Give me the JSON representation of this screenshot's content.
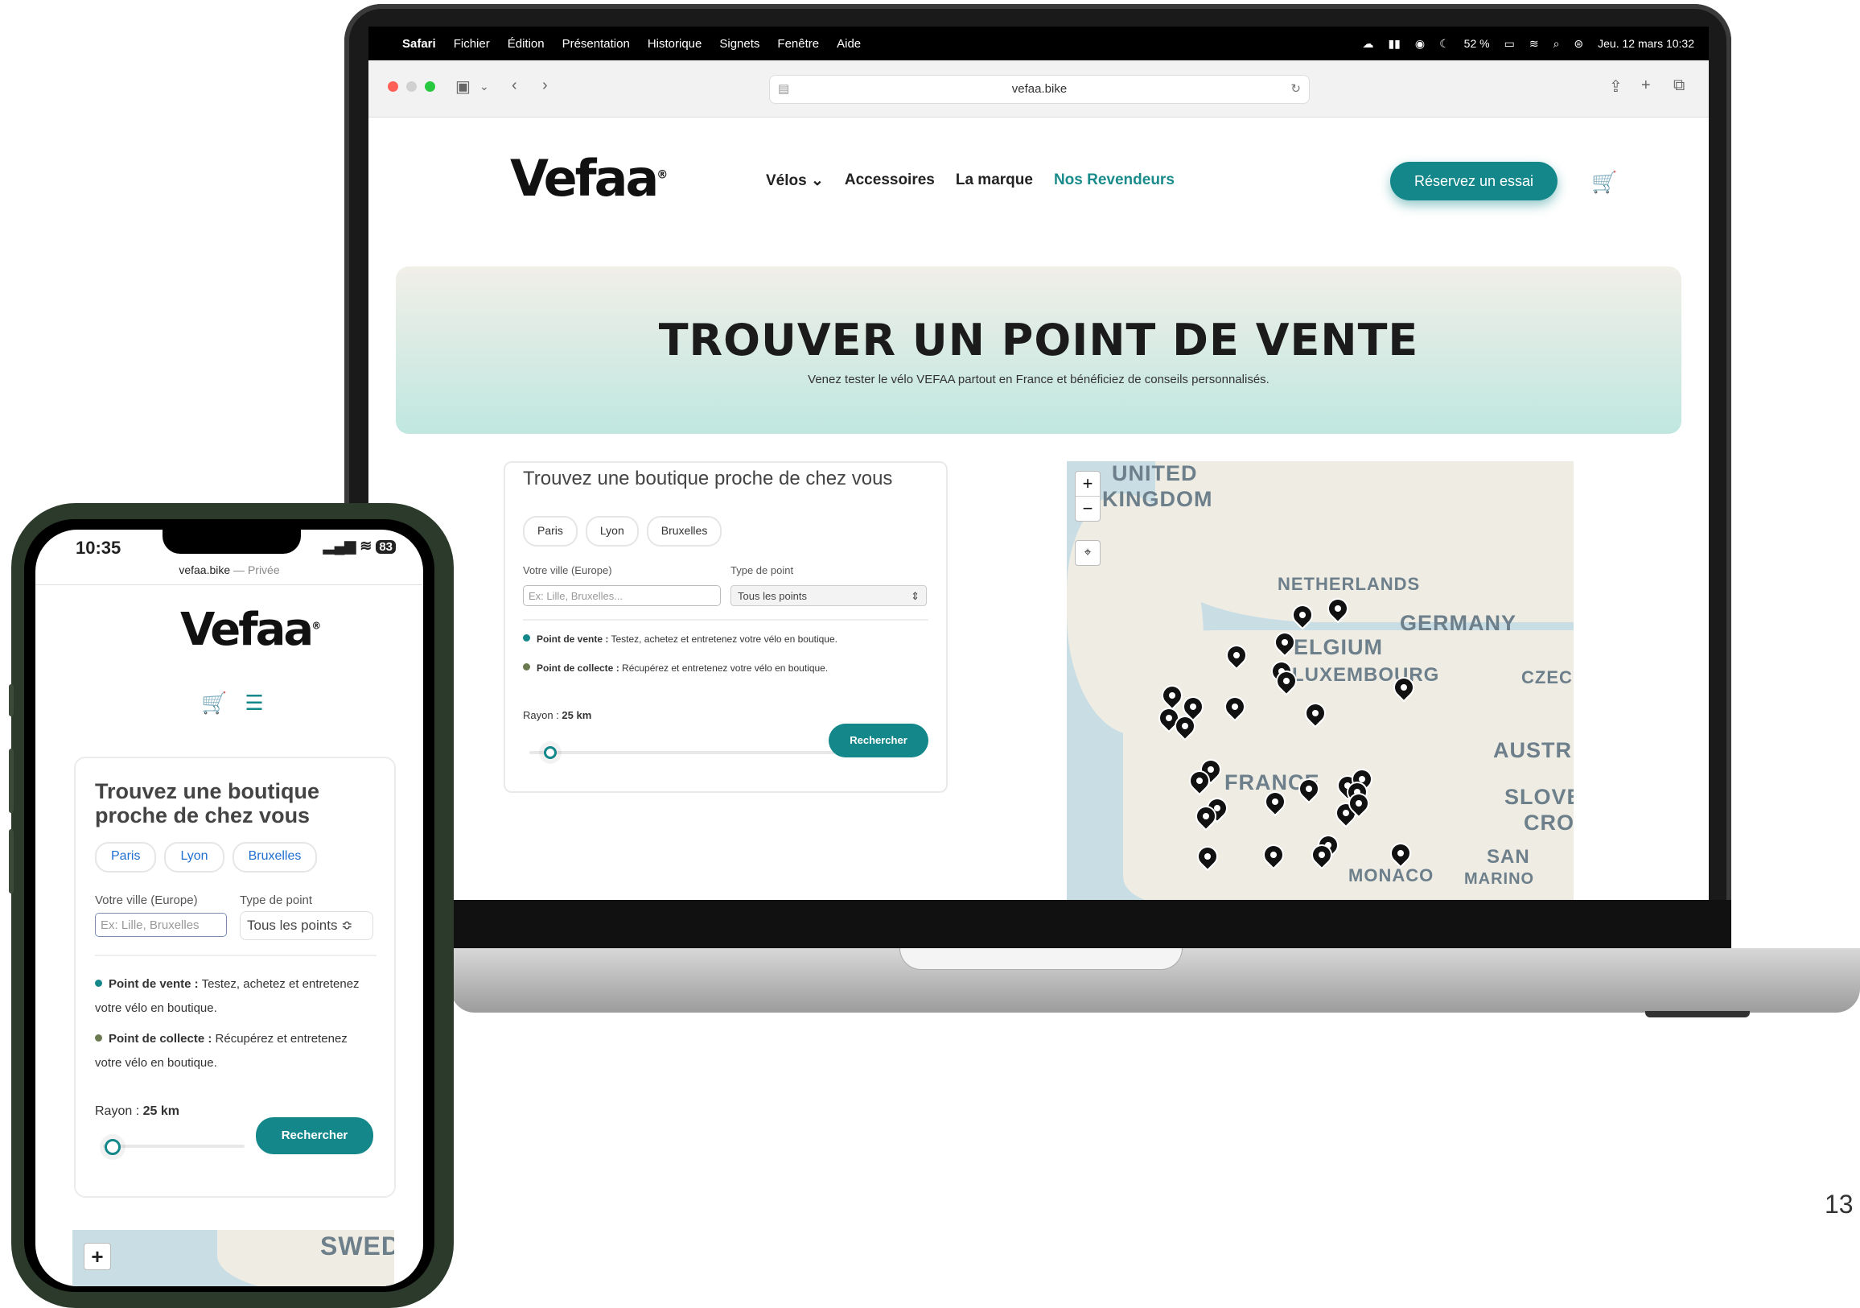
{
  "mac_menu": {
    "apple": "",
    "items": [
      "Safari",
      "Fichier",
      "Édition",
      "Présentation",
      "Historique",
      "Signets",
      "Fenêtre",
      "Aide"
    ],
    "battery": "52 %",
    "datetime": "Jeu. 12 mars  10:32"
  },
  "browser": {
    "url": "vefaa.bike"
  },
  "site": {
    "logo": "Vefaa",
    "logo_mark": "®",
    "nav": [
      "Vélos ⌄",
      "Accessoires",
      "La marque",
      "Nos Revendeurs"
    ],
    "cta": "Réservez un essai",
    "cart_icon": "🛒"
  },
  "hero": {
    "title": "TROUVER UN POINT DE VENTE",
    "subtitle": "Venez tester le vélo VEFAA partout en France et bénéficiez de conseils personnalisés."
  },
  "finder": {
    "title": "Trouvez une boutique proche de chez vous",
    "chips": [
      "Paris",
      "Lyon",
      "Bruxelles"
    ],
    "city_label": "Votre ville (Europe)",
    "city_placeholder": "Ex: Lille, Bruxelles...",
    "type_label": "Type de point",
    "type_value": "Tous les points",
    "legend_sale_title": "Point de vente :",
    "legend_sale_text": " Testez, achetez et entretenez votre vélo en boutique.",
    "legend_collect_title": "Point de collecte :",
    "legend_collect_text": " Récupérez et entretenez votre vélo en boutique.",
    "radius_label": "Rayon : ",
    "radius_value": "25 km",
    "search_button": "Rechercher",
    "sale_color": "#14878a",
    "collect_color": "#6b7a4f"
  },
  "map": {
    "zoom_in": "+",
    "zoom_out": "−",
    "locate": "⌖",
    "labels": [
      "UNITED",
      "KINGDOM",
      "NETHERLANDS",
      "GERMANY",
      "ELGIUM",
      "LUXEMBOURG",
      "CZEC",
      "AUSTR",
      "FRANCE",
      "SLOVE",
      "CRO",
      "SAN",
      "MARINO",
      "MONACO"
    ]
  },
  "phone": {
    "time": "10:35",
    "status": "83",
    "url": "vefaa.bike",
    "private": " — Privée",
    "finder_title": "Trouvez une boutique proche de chez vous",
    "city_placeholder": "Ex: Lille, Bruxelles",
    "type_value": "Tous les points ≎",
    "legend_sale_text": " Testez, achetez et entretenez votre vélo en boutique.",
    "legend_collect_text": " Récupérez et entretenez votre vélo en boutique.",
    "map_zoom_in": "+",
    "map_label": "SWED"
  },
  "page_number": "13"
}
